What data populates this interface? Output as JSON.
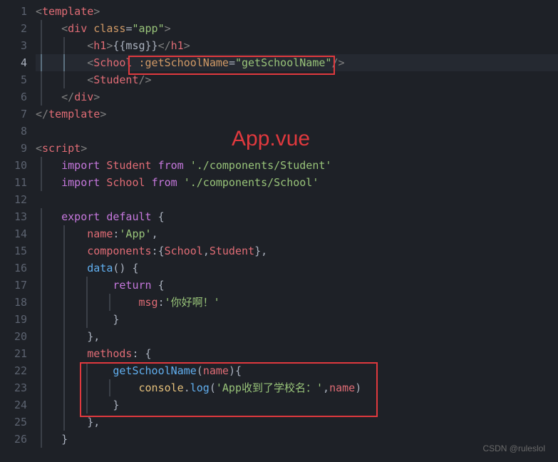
{
  "annotation_label": "App.vue",
  "watermark": "CSDN @ruleslol",
  "active_line": 4,
  "lines": {
    "1": {
      "indent": 0,
      "segs": [
        {
          "c": "tag-bracket",
          "t": "<"
        },
        {
          "c": "tag-name",
          "t": "template"
        },
        {
          "c": "tag-bracket",
          "t": ">"
        }
      ],
      "guides": []
    },
    "2": {
      "indent": 1,
      "segs": [
        {
          "c": "tag-bracket",
          "t": "<"
        },
        {
          "c": "tag-name",
          "t": "div"
        },
        {
          "c": "default",
          "t": " "
        },
        {
          "c": "attr-name",
          "t": "class"
        },
        {
          "c": "punct",
          "t": "="
        },
        {
          "c": "attr-val",
          "t": "\"app\""
        },
        {
          "c": "tag-bracket",
          "t": ">"
        }
      ],
      "guides": [
        "ig1"
      ]
    },
    "3": {
      "indent": 2,
      "segs": [
        {
          "c": "tag-bracket",
          "t": "<"
        },
        {
          "c": "tag-name",
          "t": "h1"
        },
        {
          "c": "tag-bracket",
          "t": ">"
        },
        {
          "c": "default",
          "t": "{{msg}}"
        },
        {
          "c": "tag-bracket",
          "t": "</"
        },
        {
          "c": "tag-name",
          "t": "h1"
        },
        {
          "c": "tag-bracket",
          "t": ">"
        }
      ],
      "guides": [
        "ig1",
        "ig2"
      ]
    },
    "4": {
      "indent": 2,
      "segs": [
        {
          "c": "tag-bracket",
          "t": "<"
        },
        {
          "c": "tag-name",
          "t": "School"
        },
        {
          "c": "default",
          "t": " "
        },
        {
          "c": "attr-name",
          "t": ":getSchoolName"
        },
        {
          "c": "punct",
          "t": "="
        },
        {
          "c": "attr-val",
          "t": "\"getSchoolName\""
        },
        {
          "c": "tag-bracket",
          "t": "/>"
        }
      ],
      "guides": [
        "ig1",
        "ig2"
      ]
    },
    "5": {
      "indent": 2,
      "segs": [
        {
          "c": "tag-bracket",
          "t": "<"
        },
        {
          "c": "tag-name",
          "t": "Student"
        },
        {
          "c": "tag-bracket",
          "t": "/>"
        }
      ],
      "guides": [
        "ig1",
        "ig2"
      ]
    },
    "6": {
      "indent": 1,
      "segs": [
        {
          "c": "tag-bracket",
          "t": "</"
        },
        {
          "c": "tag-name",
          "t": "div"
        },
        {
          "c": "tag-bracket",
          "t": ">"
        }
      ],
      "guides": [
        "ig1"
      ]
    },
    "7": {
      "indent": 0,
      "segs": [
        {
          "c": "tag-bracket",
          "t": "</"
        },
        {
          "c": "tag-name",
          "t": "template"
        },
        {
          "c": "tag-bracket",
          "t": ">"
        }
      ],
      "guides": []
    },
    "8": {
      "indent": 0,
      "segs": [],
      "guides": []
    },
    "9": {
      "indent": 0,
      "segs": [
        {
          "c": "tag-bracket",
          "t": "<"
        },
        {
          "c": "tag-name",
          "t": "script"
        },
        {
          "c": "tag-bracket",
          "t": ">"
        }
      ],
      "guides": []
    },
    "10": {
      "indent": 1,
      "segs": [
        {
          "c": "kw",
          "t": "import"
        },
        {
          "c": "default",
          "t": " "
        },
        {
          "c": "ident",
          "t": "Student"
        },
        {
          "c": "default",
          "t": " "
        },
        {
          "c": "kw",
          "t": "from"
        },
        {
          "c": "default",
          "t": " "
        },
        {
          "c": "str",
          "t": "'./components/Student'"
        }
      ],
      "guides": [
        "ig1"
      ]
    },
    "11": {
      "indent": 1,
      "segs": [
        {
          "c": "kw",
          "t": "import"
        },
        {
          "c": "default",
          "t": " "
        },
        {
          "c": "ident",
          "t": "School"
        },
        {
          "c": "default",
          "t": " "
        },
        {
          "c": "kw",
          "t": "from"
        },
        {
          "c": "default",
          "t": " "
        },
        {
          "c": "str",
          "t": "'./components/School'"
        }
      ],
      "guides": [
        "ig1"
      ]
    },
    "12": {
      "indent": 0,
      "segs": [],
      "guides": []
    },
    "13": {
      "indent": 1,
      "segs": [
        {
          "c": "kw",
          "t": "export"
        },
        {
          "c": "default",
          "t": " "
        },
        {
          "c": "kw",
          "t": "default"
        },
        {
          "c": "default",
          "t": " "
        },
        {
          "c": "punct",
          "t": "{"
        }
      ],
      "guides": [
        "ig1"
      ]
    },
    "14": {
      "indent": 2,
      "segs": [
        {
          "c": "prop",
          "t": "name"
        },
        {
          "c": "punct",
          "t": ":"
        },
        {
          "c": "str",
          "t": "'App'"
        },
        {
          "c": "punct",
          "t": ","
        }
      ],
      "guides": [
        "ig1",
        "ig2"
      ]
    },
    "15": {
      "indent": 2,
      "segs": [
        {
          "c": "prop",
          "t": "components"
        },
        {
          "c": "punct",
          "t": ":{"
        },
        {
          "c": "ident",
          "t": "School"
        },
        {
          "c": "punct",
          "t": ","
        },
        {
          "c": "ident",
          "t": "Student"
        },
        {
          "c": "punct",
          "t": "},"
        }
      ],
      "guides": [
        "ig1",
        "ig2"
      ]
    },
    "16": {
      "indent": 2,
      "segs": [
        {
          "c": "fn",
          "t": "data"
        },
        {
          "c": "punct",
          "t": "() {"
        }
      ],
      "guides": [
        "ig1",
        "ig2"
      ]
    },
    "17": {
      "indent": 3,
      "segs": [
        {
          "c": "kw",
          "t": "return"
        },
        {
          "c": "default",
          "t": " "
        },
        {
          "c": "punct",
          "t": "{"
        }
      ],
      "guides": [
        "ig1",
        "ig2",
        "ig3"
      ]
    },
    "18": {
      "indent": 4,
      "segs": [
        {
          "c": "prop",
          "t": "msg"
        },
        {
          "c": "punct",
          "t": ":"
        },
        {
          "c": "str",
          "t": "'你好啊！'"
        }
      ],
      "guides": [
        "ig1",
        "ig2",
        "ig3",
        "ig4"
      ]
    },
    "19": {
      "indent": 3,
      "segs": [
        {
          "c": "punct",
          "t": "}"
        }
      ],
      "guides": [
        "ig1",
        "ig2",
        "ig3"
      ]
    },
    "20": {
      "indent": 2,
      "segs": [
        {
          "c": "punct",
          "t": "},"
        }
      ],
      "guides": [
        "ig1",
        "ig2"
      ]
    },
    "21": {
      "indent": 2,
      "segs": [
        {
          "c": "prop",
          "t": "methods"
        },
        {
          "c": "punct",
          "t": ": {"
        }
      ],
      "guides": [
        "ig1",
        "ig2"
      ]
    },
    "22": {
      "indent": 3,
      "segs": [
        {
          "c": "fn",
          "t": "getSchoolName"
        },
        {
          "c": "punct",
          "t": "("
        },
        {
          "c": "param",
          "t": "name"
        },
        {
          "c": "punct",
          "t": "){"
        }
      ],
      "guides": [
        "ig1",
        "ig2",
        "ig3"
      ]
    },
    "23": {
      "indent": 4,
      "segs": [
        {
          "c": "builtin",
          "t": "console"
        },
        {
          "c": "punct",
          "t": "."
        },
        {
          "c": "fn",
          "t": "log"
        },
        {
          "c": "punct",
          "t": "("
        },
        {
          "c": "str",
          "t": "'App收到了学校名：'"
        },
        {
          "c": "punct",
          "t": ","
        },
        {
          "c": "ident",
          "t": "name"
        },
        {
          "c": "punct",
          "t": ")"
        }
      ],
      "guides": [
        "ig1",
        "ig2",
        "ig3",
        "ig4"
      ]
    },
    "24": {
      "indent": 3,
      "segs": [
        {
          "c": "punct",
          "t": "}"
        }
      ],
      "guides": [
        "ig1",
        "ig2",
        "ig3"
      ]
    },
    "25": {
      "indent": 2,
      "segs": [
        {
          "c": "punct",
          "t": "},"
        }
      ],
      "guides": [
        "ig1",
        "ig2"
      ]
    },
    "26": {
      "indent": 1,
      "segs": [
        {
          "c": "punct",
          "t": "}"
        }
      ],
      "guides": [
        "ig1"
      ]
    }
  }
}
